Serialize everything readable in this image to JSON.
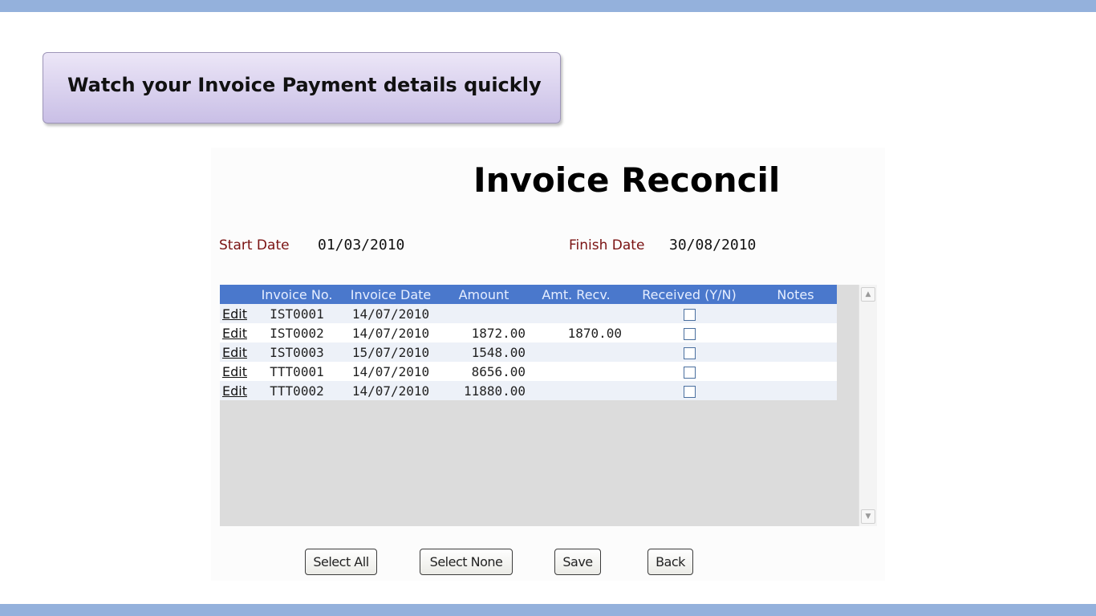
{
  "banner": {
    "text": "Watch your Invoice Payment details quickly"
  },
  "page": {
    "title": "Invoice Reconcil",
    "start_date_label": "Start Date",
    "start_date": "01/03/2010",
    "finish_date_label": "Finish Date",
    "finish_date": "30/08/2010"
  },
  "table": {
    "columns": [
      "",
      "Invoice No.",
      "Invoice Date",
      "Amount",
      "Amt. Recv.",
      "Received (Y/N)",
      "Notes"
    ],
    "rows": [
      {
        "action": "Edit",
        "invoice_no": "IST0001",
        "invoice_date": "14/07/2010",
        "amount": "",
        "amt_recv": "",
        "received": false,
        "notes": ""
      },
      {
        "action": "Edit",
        "invoice_no": "IST0002",
        "invoice_date": "14/07/2010",
        "amount": "1872.00",
        "amt_recv": "1870.00",
        "received": false,
        "notes": ""
      },
      {
        "action": "Edit",
        "invoice_no": "IST0003",
        "invoice_date": "15/07/2010",
        "amount": "1548.00",
        "amt_recv": "",
        "received": false,
        "notes": ""
      },
      {
        "action": "Edit",
        "invoice_no": "TTT0001",
        "invoice_date": "14/07/2010",
        "amount": "8656.00",
        "amt_recv": "",
        "received": false,
        "notes": ""
      },
      {
        "action": "Edit",
        "invoice_no": "TTT0002",
        "invoice_date": "14/07/2010",
        "amount": "11880.00",
        "amt_recv": "",
        "received": false,
        "notes": ""
      }
    ]
  },
  "buttons": {
    "select_all": "Select All",
    "select_none": "Select None",
    "save": "Save",
    "back": "Back"
  },
  "colors": {
    "frame_bar": "#94b1dc",
    "header_bg": "#4a78cc",
    "date_label": "#7a1212",
    "banner_bg": "#d9d1f0"
  },
  "icons": {
    "scroll_up": "chevron-up-icon",
    "scroll_down": "chevron-down-icon"
  }
}
